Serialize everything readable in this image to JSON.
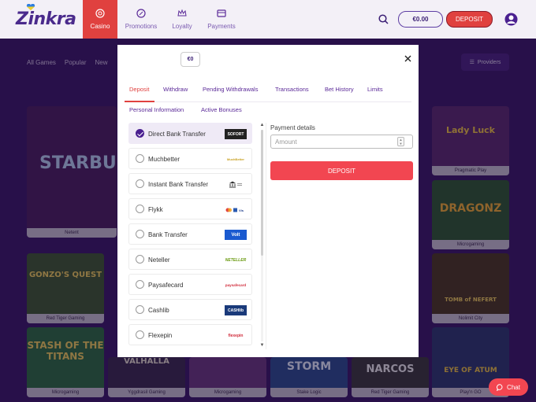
{
  "header": {
    "logo": "Zinkra",
    "nav": [
      {
        "label": "Casino",
        "icon": "casino-chip-icon",
        "active": true
      },
      {
        "label": "Promotions",
        "icon": "promotions-icon",
        "active": false
      },
      {
        "label": "Loyalty",
        "icon": "loyalty-crown-icon",
        "active": false
      },
      {
        "label": "Payments",
        "icon": "payments-icon",
        "active": false
      }
    ],
    "balance": "€0.00",
    "deposit_label": "DEPOSIT",
    "accent": "#e0413f"
  },
  "background": {
    "filters": [
      "All Games",
      "Popular",
      "New"
    ],
    "providers_label": "Providers",
    "tiles": [
      {
        "title": "STARBU",
        "provider": "Netent"
      },
      {
        "title": "Lady Luck",
        "provider": "Pragmatic Play"
      },
      {
        "title": "DRAGONZ",
        "provider": "Microgaming"
      },
      {
        "title": "GONZO'S QUEST",
        "provider": "Red Tiger Gaming"
      },
      {
        "title": "TOMB of NEFERT",
        "provider": "Nolimit City"
      },
      {
        "title": "STASH OF THE TITANS",
        "provider": "Microgaming"
      },
      {
        "title": "VALHALLA",
        "provider": "Yggdrasil Gaming"
      },
      {
        "title": "",
        "provider": "Microgaming"
      },
      {
        "title": "STORM",
        "provider": "Stake Logic"
      },
      {
        "title": "NARCOS",
        "provider": "Red Tiger Gaming"
      },
      {
        "title": "EYE OF ATUM",
        "provider": "Play'n GO"
      }
    ]
  },
  "modal": {
    "balance": "€0",
    "tabs_row1": [
      "Deposit",
      "Withdraw",
      "Pending Withdrawals",
      "Transactions",
      "Bet History",
      "Limits"
    ],
    "tabs_row2": [
      "Personal Information",
      "Active Bonuses"
    ],
    "active_tab": "Deposit",
    "payment_methods": [
      {
        "label": "Direct Bank Transfer",
        "logo": "SOFORT",
        "selected": true
      },
      {
        "label": "Muchbetter",
        "logo": "MuchBetter",
        "selected": false
      },
      {
        "label": "Instant Bank Transfer",
        "logo": "bank-icon",
        "selected": false
      },
      {
        "label": "Flykk",
        "logo": "cards-icon",
        "selected": false
      },
      {
        "label": "Bank Transfer",
        "logo": "Volt",
        "selected": false
      },
      {
        "label": "Neteller",
        "logo": "NETELLER",
        "selected": false
      },
      {
        "label": "Paysafecard",
        "logo": "paysafecard",
        "selected": false
      },
      {
        "label": "Cashlib",
        "logo": "CASHlib",
        "selected": false
      },
      {
        "label": "Flexepin",
        "logo": "flexepin",
        "selected": false
      }
    ],
    "payment_details_label": "Payment details",
    "amount_placeholder": "Amount",
    "deposit_button": "DEPOSIT"
  },
  "chat_label": "Chat"
}
